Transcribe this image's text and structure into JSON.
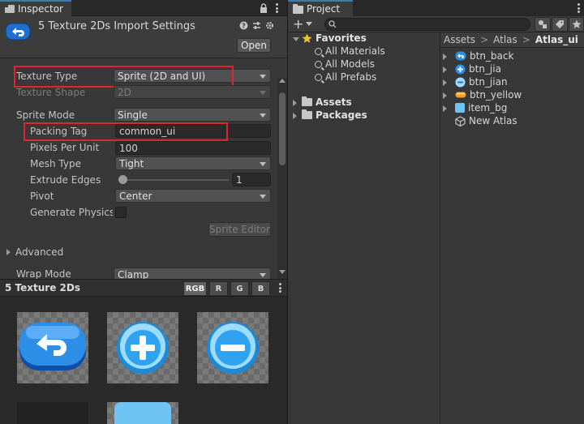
{
  "inspector": {
    "tab_label": "Inspector",
    "title": "5 Texture 2Ds Import Settings",
    "open_button": "Open",
    "fields": {
      "texture_type_label": "Texture Type",
      "texture_type_value": "Sprite (2D and UI)",
      "texture_shape_label": "Texture Shape",
      "texture_shape_value": "2D",
      "sprite_mode_label": "Sprite Mode",
      "sprite_mode_value": "Single",
      "packing_tag_label": "Packing Tag",
      "packing_tag_value": "common_ui",
      "pixels_per_unit_label": "Pixels Per Unit",
      "pixels_per_unit_value": "100",
      "mesh_type_label": "Mesh Type",
      "mesh_type_value": "Tight",
      "extrude_edges_label": "Extrude Edges",
      "extrude_edges_value": "1",
      "pivot_label": "Pivot",
      "pivot_value": "Center",
      "generate_physics_label": "Generate Physics S",
      "sprite_editor_button": "Sprite Editor",
      "advanced_label": "Advanced",
      "wrap_mode_label": "Wrap Mode",
      "wrap_mode_value": "Clamp"
    },
    "preview": {
      "title": "5 Texture 2Ds",
      "channels": [
        "RGB",
        "R",
        "G",
        "B"
      ]
    }
  },
  "project": {
    "tab_label": "Project",
    "add_button": "+",
    "favorites_label": "Favorites",
    "favorites": [
      "All Materials",
      "All Models",
      "All Prefabs"
    ],
    "roots": [
      "Assets",
      "Packages"
    ],
    "breadcrumb": [
      "Assets",
      "Atlas",
      "Atlas_ui"
    ],
    "assets": [
      "btn_back",
      "btn_jia",
      "btn_jian",
      "btn_yellow",
      "item_bg",
      "New Atlas"
    ]
  },
  "colors": {
    "highlight_box": "#e0252c",
    "tab_accent": "#3a79bb",
    "icon_blue": "#2d8ee8",
    "button_blue": "#1f6fd1"
  }
}
